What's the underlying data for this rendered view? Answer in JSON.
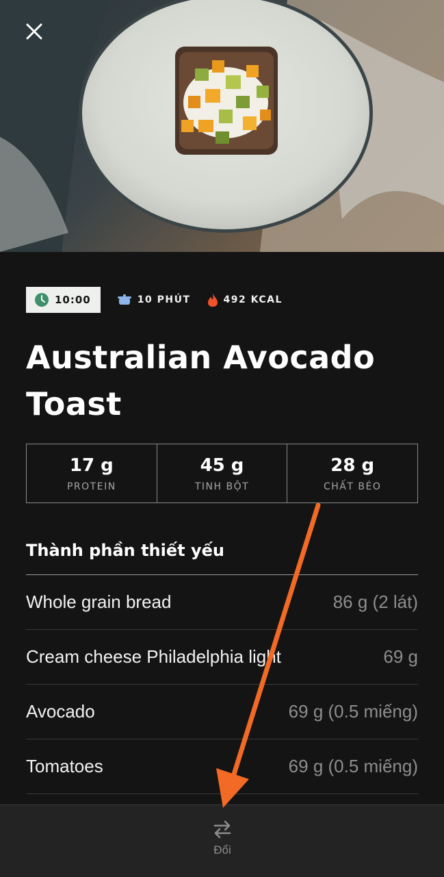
{
  "header": {
    "close_icon": "close-icon"
  },
  "hero_image": {
    "description_icon": "food-photo-avocado-toast"
  },
  "meta": {
    "time": "10:00",
    "duration": "10 PHÚT",
    "calories": "492 KCAL",
    "icons": {
      "time": "clock-icon",
      "duration": "pot-icon",
      "calories": "flame-icon"
    },
    "colors": {
      "clock": "#3f8f6a",
      "pot": "#8fb4ea",
      "flame": "#f0522b"
    }
  },
  "recipe": {
    "title_line1": "Australian Avocado",
    "title_line2": "Toast"
  },
  "macros": [
    {
      "value": "17 g",
      "name": "PROTEIN"
    },
    {
      "value": "45 g",
      "name": "TINH BỘT"
    },
    {
      "value": "28 g",
      "name": "CHẤT BÉO"
    }
  ],
  "ingredients": {
    "heading": "Thành phần thiết yếu",
    "items": [
      {
        "name": "Whole grain bread",
        "amount": "86 g (2 lát)"
      },
      {
        "name": "Cream cheese Philadelphia light",
        "amount": "69 g"
      },
      {
        "name": "Avocado",
        "amount": "69 g (0.5 miếng)"
      },
      {
        "name": "Tomatoes",
        "amount": "69 g (0.5 miếng)"
      }
    ]
  },
  "bottom_bar": {
    "swap_label": "Đổi",
    "swap_icon": "swap-arrows-icon"
  },
  "annotation": {
    "arrow_color": "#f26a26"
  }
}
